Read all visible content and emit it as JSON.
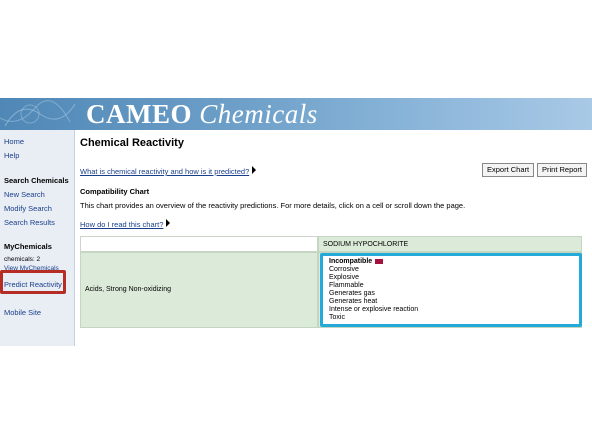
{
  "banner": {
    "title_part1": "CAMEO",
    "title_part2": "Chemicals"
  },
  "sidebar": {
    "home": "Home",
    "help": "Help",
    "search_header": "Search Chemicals",
    "new_search": "New Search",
    "modify_search": "Modify Search",
    "search_results": "Search Results",
    "mychemicals_header": "MyChemicals",
    "chemicals_count": "chemicals: 2",
    "view_mychemicals": "View MyChemicals",
    "predict_reactivity": "Predict Reactivity",
    "mobile_site": "Mobile Site"
  },
  "main": {
    "page_title": "Chemical Reactivity",
    "what_is_link": "What is chemical reactivity and how is it predicted?",
    "export_chart": "Export Chart",
    "print_report": "Print Report",
    "compat_title": "Compatibility Chart",
    "compat_desc": "This chart provides an overview of the reactivity predictions. For more details, click on a cell or scroll down the page.",
    "how_read_link": "How do I read this chart?"
  },
  "chart": {
    "chemical": "SODIUM HYPOCHLORITE",
    "reactive_group": "Acids, Strong Non-oxidizing",
    "result_status": "Incompatible",
    "hazards": [
      "Corrosive",
      "Explosive",
      "Flammable",
      "Generates gas",
      "Generates heat",
      "Intense or explosive reaction",
      "Toxic"
    ]
  },
  "colors": {
    "banner_start": "#4f87b6",
    "highlight_red": "#b52d24",
    "highlight_blue": "#24a9d9",
    "incompatible_swatch": "#a4123f",
    "cell_green": "#dcebd9",
    "link_blue": "#1a3f8a"
  }
}
